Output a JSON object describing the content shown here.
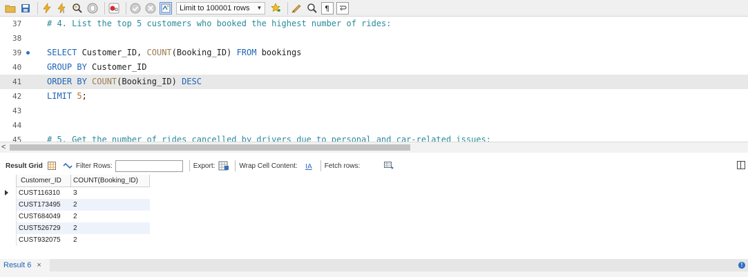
{
  "toolbar": {
    "limit_label": "Limit to 100001 rows",
    "icons": [
      "folder-open-icon",
      "save-icon",
      "execute-icon",
      "execute-current-icon",
      "explain-icon",
      "stop-icon",
      "toggle-error-icon",
      "commit-icon",
      "rollback-icon",
      "autocommit-icon",
      "beautify-icon",
      "clean-icon",
      "find-icon",
      "invisibles-icon",
      "wrap-icon"
    ]
  },
  "editor": {
    "lines": [
      {
        "num": "37",
        "segments": [
          {
            "t": "# 4. List the top 5 customers who booked the highest number of rides:",
            "c": "cm"
          }
        ]
      },
      {
        "num": "38",
        "segments": []
      },
      {
        "num": "39",
        "dot": true,
        "segments": [
          {
            "t": "SELECT",
            "c": "kw"
          },
          {
            "t": " Customer_ID, ",
            "c": "txt"
          },
          {
            "t": "COUNT",
            "c": "fn"
          },
          {
            "t": "(Booking_ID) ",
            "c": "txt"
          },
          {
            "t": "FROM",
            "c": "kw"
          },
          {
            "t": " bookings",
            "c": "txt"
          }
        ]
      },
      {
        "num": "40",
        "segments": [
          {
            "t": "GROUP BY",
            "c": "kw"
          },
          {
            "t": " Customer_ID",
            "c": "txt"
          }
        ]
      },
      {
        "num": "41",
        "highlight": true,
        "segments": [
          {
            "t": "ORDER BY",
            "c": "kw"
          },
          {
            "t": " ",
            "c": "txt"
          },
          {
            "t": "COUNT",
            "c": "fn"
          },
          {
            "t": "(Booking_ID) ",
            "c": "txt"
          },
          {
            "t": "DESC",
            "c": "kw"
          }
        ]
      },
      {
        "num": "42",
        "segments": [
          {
            "t": "LIMIT",
            "c": "kw"
          },
          {
            "t": " ",
            "c": "txt"
          },
          {
            "t": "5",
            "c": "num"
          },
          {
            "t": ";",
            "c": "txt"
          }
        ]
      },
      {
        "num": "43",
        "segments": []
      },
      {
        "num": "44",
        "segments": []
      },
      {
        "num": "45",
        "segments": [
          {
            "t": "# 5. Get the number of rides cancelled by drivers due to personal and car-related issues:",
            "c": "cm"
          }
        ]
      }
    ]
  },
  "results_toolbar": {
    "result_grid": "Result Grid",
    "filter_rows": "Filter Rows:",
    "export": "Export:",
    "wrap_cell": "Wrap Cell Content:",
    "fetch_rows": "Fetch rows:"
  },
  "grid": {
    "columns": [
      "Customer_ID",
      "COUNT(Booking_ID)"
    ],
    "rows": [
      [
        "CUST116310",
        "3"
      ],
      [
        "CUST173495",
        "2"
      ],
      [
        "CUST684049",
        "2"
      ],
      [
        "CUST526729",
        "2"
      ],
      [
        "CUST932075",
        "2"
      ]
    ]
  },
  "tabs": {
    "result_tab": "Result 6",
    "close": "×"
  },
  "colors": {
    "keyword": "#1e64b4",
    "function": "#9a7a50",
    "comment": "#2a8a9a",
    "number": "#b07030"
  }
}
